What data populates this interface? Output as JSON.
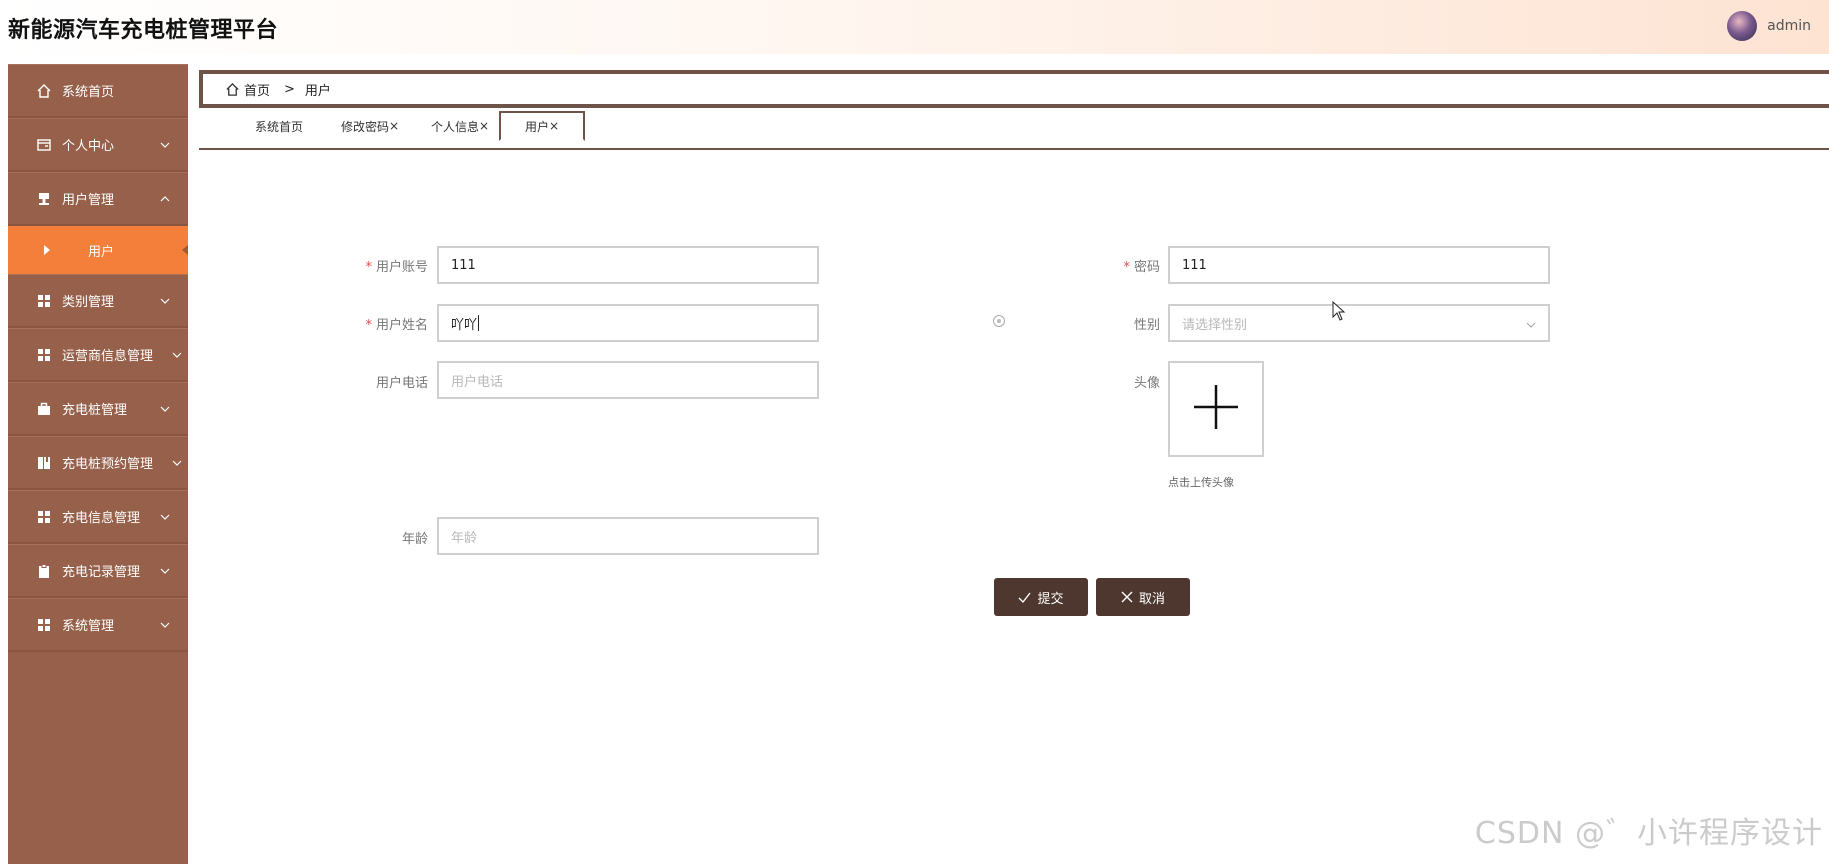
{
  "app": {
    "title": "新能源汽车充电桩管理平台",
    "username": "admin"
  },
  "sidebar": {
    "items": [
      {
        "label": "系统首页",
        "icon": "home-icon",
        "has_chevron": false
      },
      {
        "label": "个人中心",
        "icon": "wallet-icon",
        "has_chevron": true
      },
      {
        "label": "用户管理",
        "icon": "stamp-icon",
        "has_chevron": true,
        "expanded": true
      },
      {
        "label": "类别管理",
        "icon": "grid-icon",
        "has_chevron": true
      },
      {
        "label": "运营商信息管理",
        "icon": "grid-icon",
        "has_chevron": true
      },
      {
        "label": "充电桩管理",
        "icon": "briefcase-icon",
        "has_chevron": true
      },
      {
        "label": "充电桩预约管理",
        "icon": "book-icon",
        "has_chevron": true
      },
      {
        "label": "充电信息管理",
        "icon": "grid-icon",
        "has_chevron": true
      },
      {
        "label": "充电记录管理",
        "icon": "clipboard-icon",
        "has_chevron": true
      },
      {
        "label": "系统管理",
        "icon": "grid-icon",
        "has_chevron": true
      }
    ],
    "active_sub": "用户"
  },
  "breadcrumb": {
    "home": "首页",
    "separator": ">",
    "current": "用户"
  },
  "tabs": [
    {
      "label": "系统首页",
      "closable": false
    },
    {
      "label": "修改密码",
      "closable": true
    },
    {
      "label": "个人信息",
      "closable": true
    },
    {
      "label": "用户",
      "closable": true,
      "active": true
    }
  ],
  "tab_close_glyph": "×",
  "form": {
    "account": {
      "label": "用户账号",
      "value": "111",
      "required": true
    },
    "password": {
      "label": "密码",
      "value": "111",
      "required": true
    },
    "name": {
      "label": "用户姓名",
      "value": "吖吖",
      "required": true
    },
    "gender": {
      "label": "性别",
      "placeholder": "请选择性别"
    },
    "phone": {
      "label": "用户电话",
      "placeholder": "用户电话"
    },
    "avatar": {
      "label": "头像",
      "hint": "点击上传头像"
    },
    "age": {
      "label": "年龄",
      "placeholder": "年龄"
    },
    "submit_label": "提交",
    "cancel_label": "取消"
  },
  "watermark": "CSDN @゛小许程序设计",
  "colors": {
    "sidebar": "#96604a",
    "active": "#f47f3b",
    "button": "#4e372f",
    "frame": "#6e5348"
  }
}
